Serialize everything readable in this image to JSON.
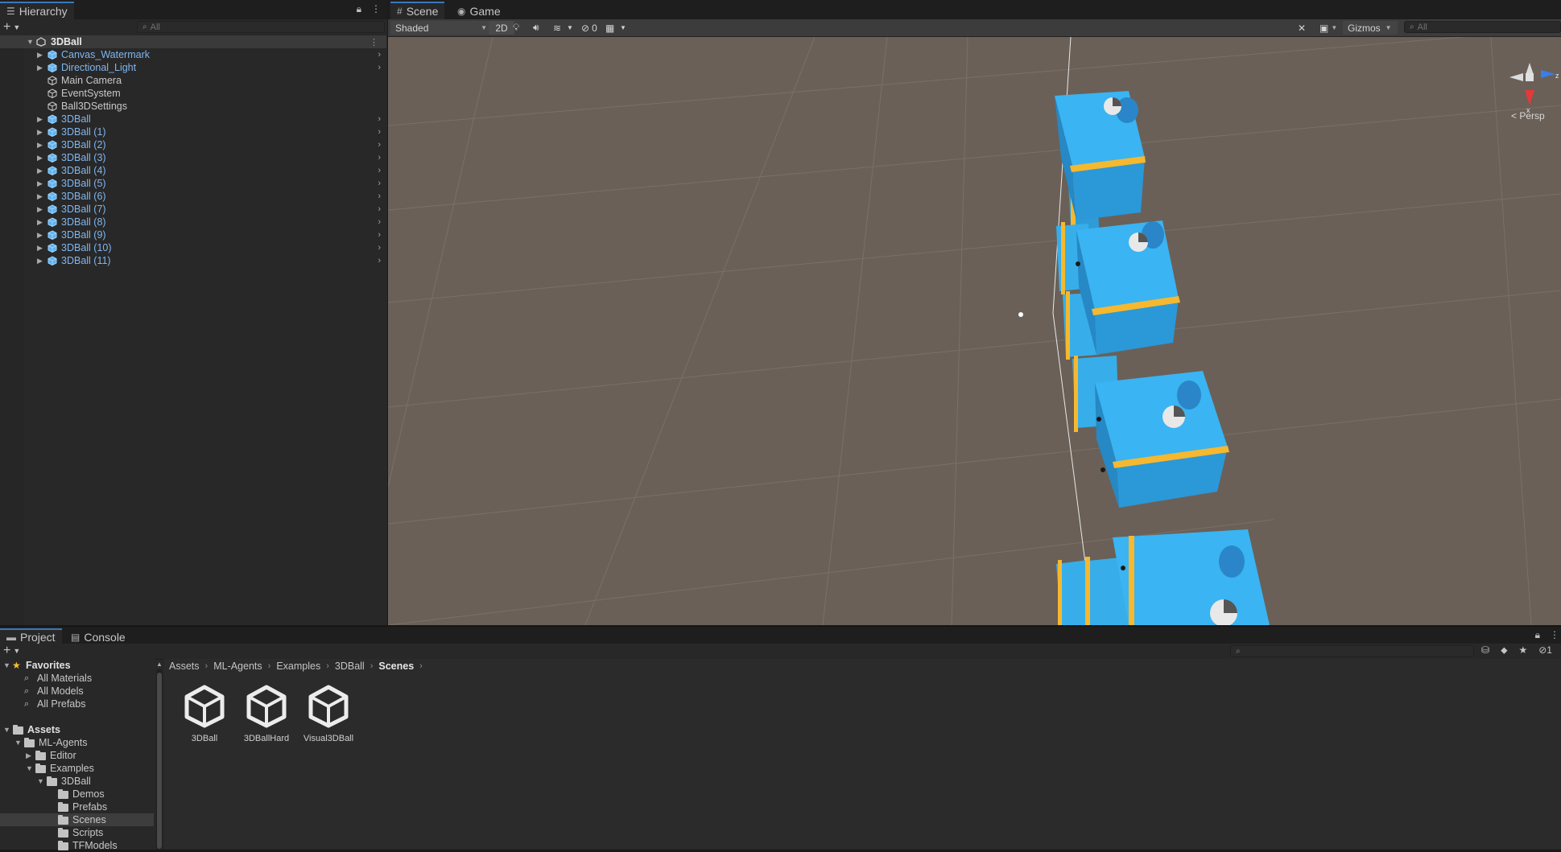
{
  "hierarchy": {
    "tab": "Hierarchy",
    "search_placeholder": "All",
    "scene": "3DBall",
    "items": [
      {
        "label": "Canvas_Watermark",
        "kind": "prefab",
        "expandable": true
      },
      {
        "label": "Directional_Light",
        "kind": "prefab",
        "expandable": true
      },
      {
        "label": "Main Camera",
        "kind": "plain",
        "expandable": false
      },
      {
        "label": "EventSystem",
        "kind": "plain",
        "expandable": false
      },
      {
        "label": "Ball3DSettings",
        "kind": "plain",
        "expandable": false
      },
      {
        "label": "3DBall",
        "kind": "prefab",
        "expandable": true
      },
      {
        "label": "3DBall (1)",
        "kind": "prefab",
        "expandable": true
      },
      {
        "label": "3DBall (2)",
        "kind": "prefab",
        "expandable": true
      },
      {
        "label": "3DBall (3)",
        "kind": "prefab",
        "expandable": true
      },
      {
        "label": "3DBall (4)",
        "kind": "prefab",
        "expandable": true
      },
      {
        "label": "3DBall (5)",
        "kind": "prefab",
        "expandable": true
      },
      {
        "label": "3DBall (6)",
        "kind": "prefab",
        "expandable": true
      },
      {
        "label": "3DBall (7)",
        "kind": "prefab",
        "expandable": true
      },
      {
        "label": "3DBall (8)",
        "kind": "prefab",
        "expandable": true
      },
      {
        "label": "3DBall (9)",
        "kind": "prefab",
        "expandable": true
      },
      {
        "label": "3DBall (10)",
        "kind": "prefab",
        "expandable": true
      },
      {
        "label": "3DBall (11)",
        "kind": "prefab",
        "expandable": true
      }
    ]
  },
  "scene_view": {
    "tabs": [
      "Scene",
      "Game"
    ],
    "shading_mode": "Shaded",
    "toggle_2d": "2D",
    "hidden_count": "0",
    "gizmos_label": "Gizmos",
    "search_placeholder": "All",
    "projection_label": "Persp",
    "orientation_axes": [
      "z",
      "x"
    ]
  },
  "project": {
    "tabs": [
      "Project",
      "Console"
    ],
    "favorites_title": "Favorites",
    "favorites": [
      "All Materials",
      "All Models",
      "All Prefabs"
    ],
    "tree": [
      {
        "label": "Assets",
        "bold": true
      },
      {
        "label": "ML-Agents"
      },
      {
        "label": "Editor"
      },
      {
        "label": "Examples"
      },
      {
        "label": "3DBall"
      },
      {
        "label": "Demos"
      },
      {
        "label": "Prefabs"
      },
      {
        "label": "Scenes",
        "selected": true
      },
      {
        "label": "Scripts"
      },
      {
        "label": "TFModels"
      }
    ],
    "breadcrumb": [
      "Assets",
      "ML-Agents",
      "Examples",
      "3DBall",
      "Scenes"
    ],
    "assets": [
      "3DBall",
      "3DBallHard",
      "Visual3DBall"
    ],
    "hidden_packages_count": "1"
  },
  "colors": {
    "accent_tab": "#3a79bb",
    "prefab_text": "#7fb6f0",
    "agent_cube": "#3ab4f2",
    "platform_edge": "#f5b82e",
    "floor": "#6a6058"
  }
}
